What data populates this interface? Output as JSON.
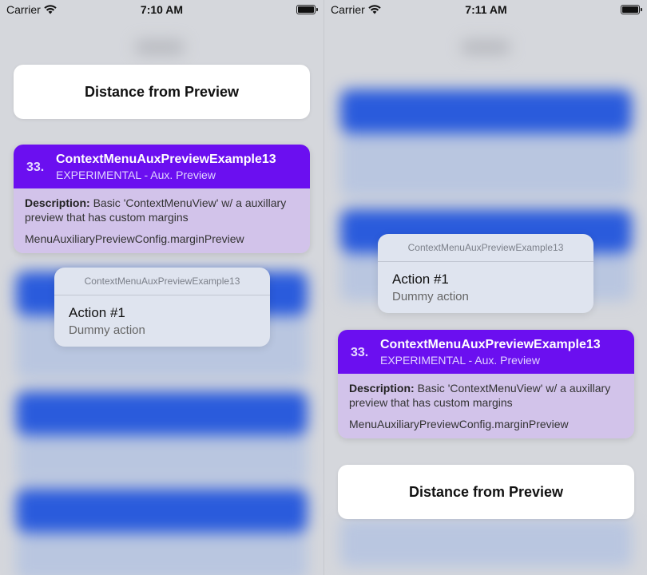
{
  "screens": [
    {
      "status": {
        "carrier": "Carrier",
        "time": "7:10 AM"
      },
      "distance_button": {
        "label": "Distance from Preview"
      },
      "preview": {
        "number": "33.",
        "title": "ContextMenuAuxPreviewExample13",
        "subtitle": "EXPERIMENTAL - Aux. Preview",
        "description_label": "Description:",
        "description_text": " Basic 'ContextMenuView' w/ a auxillary preview that has custom margins",
        "config": "MenuAuxiliaryPreviewConfig.marginPreview"
      },
      "menu": {
        "header": "ContextMenuAuxPreviewExample13",
        "item_title": "Action #1",
        "item_subtitle": "Dummy action"
      }
    },
    {
      "status": {
        "carrier": "Carrier",
        "time": "7:11 AM"
      },
      "distance_button": {
        "label": "Distance from Preview"
      },
      "preview": {
        "number": "33.",
        "title": "ContextMenuAuxPreviewExample13",
        "subtitle": "EXPERIMENTAL - Aux. Preview",
        "description_label": "Description:",
        "description_text": " Basic 'ContextMenuView' w/ a auxillary preview that has custom margins",
        "config": "MenuAuxiliaryPreviewConfig.marginPreview"
      },
      "menu": {
        "header": "ContextMenuAuxPreviewExample13",
        "item_title": "Action #1",
        "item_subtitle": "Dummy action"
      }
    }
  ],
  "colors": {
    "preview_header": "#6b0ff0",
    "preview_body": "#d2c3ea",
    "menu_background": "#dfe4ef",
    "background_card": "#2a5bdc"
  },
  "icons": {
    "wifi": "wifi-icon",
    "battery": "battery-icon"
  }
}
